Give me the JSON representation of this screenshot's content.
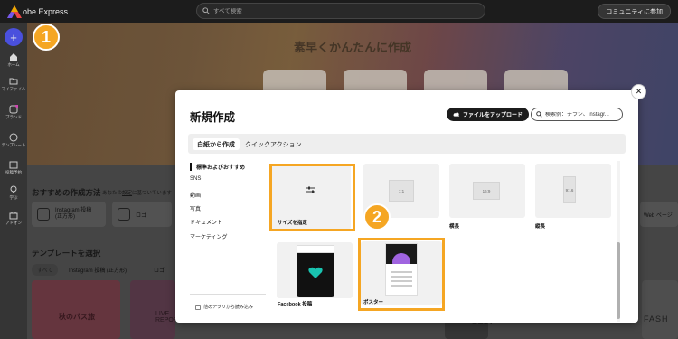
{
  "topbar": {
    "app_name": "obe Express",
    "search_placeholder": "すべて検索",
    "community_button": "コミュニティに参加"
  },
  "sidebar": {
    "items": [
      {
        "label": "ホーム",
        "icon": "home-icon"
      },
      {
        "label": "マイファイル",
        "icon": "folder-icon"
      },
      {
        "label": "ブランド",
        "icon": "brand-icon"
      },
      {
        "label": "テンプレート",
        "icon": "template-icon"
      },
      {
        "label": "投稿予約",
        "icon": "calendar-icon"
      },
      {
        "label": "学ぶ",
        "icon": "lightbulb-icon"
      },
      {
        "label": "アドオン",
        "icon": "addon-icon"
      }
    ]
  },
  "background_page": {
    "hero_title": "素早くかんたんに作成",
    "recommend_title": "おすすめの作成方法",
    "recommend_sub": "あなたの",
    "recommend_link": "設定",
    "recommend_sub_tail": "に基づいています",
    "chips": [
      "Instagram 投稿 (正方形)",
      "ロゴ",
      "Web ページ"
    ],
    "template_title": "テンプレートを選択",
    "template_tabs": [
      "すべて",
      "Instagram 投稿 (正方形)",
      "ロゴ"
    ],
    "thumb_texts": [
      "秋のバス旅",
      "LIVE REPORT",
      "BEST",
      "FASH"
    ]
  },
  "modal": {
    "title": "新規作成",
    "upload_button": "ファイルをアップロード",
    "search_placeholder": "検索例：チラシ、Instagr...",
    "tabs": [
      "白紙から作成",
      "クイックアクション"
    ],
    "categories": [
      "標準およびおすすめ",
      "SNS",
      "動画",
      "写真",
      "ドキュメント",
      "マーケティング"
    ],
    "import_link": "他のアプリから読み込み",
    "cards": {
      "custom_size": "サイズを指定",
      "square_ratio": "1:1",
      "landscape_ratio": "16:9",
      "landscape_label": "横長",
      "portrait_ratio": "9:16",
      "portrait_label": "縦長",
      "facebook_post": "Facebook 投稿",
      "poster": "ポスター"
    }
  },
  "annotations": {
    "step1": "1",
    "step2": "2"
  },
  "colors": {
    "accent_plus": "#5157f0",
    "highlight": "#f5a623"
  }
}
